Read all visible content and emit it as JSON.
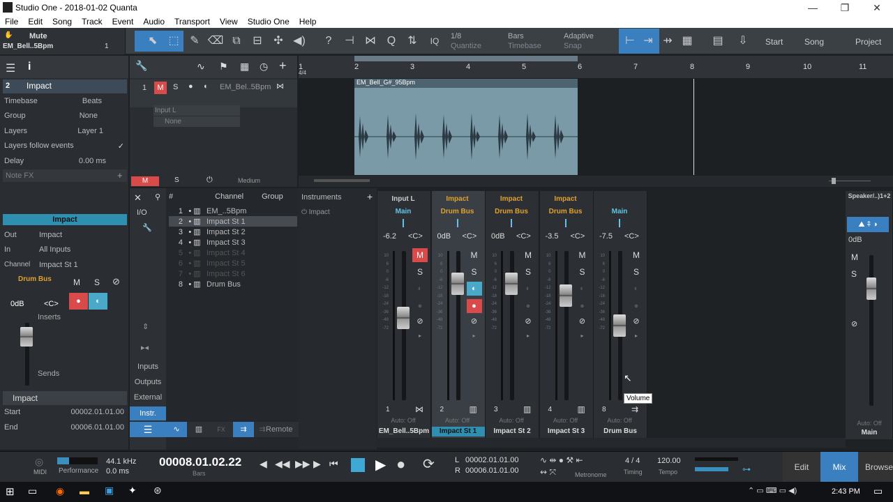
{
  "window": {
    "title": "Studio One - 2018-01-02 Quanta",
    "min": "—",
    "max": "❐",
    "close": "✕"
  },
  "menu": [
    "File",
    "Edit",
    "Song",
    "Track",
    "Event",
    "Audio",
    "Transport",
    "View",
    "Studio One",
    "Help"
  ],
  "toolbar": {
    "mute_label": "Mute",
    "track_name": "EM_Bell..5Bpm",
    "track_num": "1",
    "quantize_val": "1/8",
    "quantize_lbl": "Quantize",
    "timebase_val": "Bars",
    "timebase_lbl": "Timebase",
    "snap_val": "Adaptive",
    "snap_lbl": "Snap",
    "iq": "IQ",
    "start": "Start",
    "song": "Song",
    "project": "Project"
  },
  "inspector": {
    "track_num": "2",
    "track_name": "Impact",
    "rows": [
      {
        "k": "Timebase",
        "v": "Beats"
      },
      {
        "k": "Group",
        "v": "None"
      },
      {
        "k": "Layers",
        "v": "Layer 1"
      },
      {
        "k": "Layers follow events",
        "v": "✓"
      },
      {
        "k": "Delay",
        "v": "0.00 ms"
      }
    ],
    "note_fx": "Note FX",
    "channel_title": "Impact",
    "io": [
      {
        "k": "Out",
        "v": "Impact"
      },
      {
        "k": "In",
        "v": "All Inputs"
      },
      {
        "k": "Channel",
        "v": "Impact St 1"
      }
    ],
    "bus": "Drum Bus",
    "m": "M",
    "s": "S",
    "vol": "0dB",
    "pan": "<C>",
    "inserts": "Inserts",
    "sends": "Sends",
    "event_title": "Impact",
    "start_k": "Start",
    "start_v": "00002.01.01.00",
    "end_k": "End",
    "end_v": "00006.01.01.00"
  },
  "arrange": {
    "track_num": "1",
    "track_name": "EM_Bel..5Bpm",
    "m": "M",
    "s": "S",
    "input": "Input L",
    "none": "None",
    "clip_name": "EM_Bell_G#_95Bpm",
    "sig": "4/4",
    "ruler": [
      "1",
      "2",
      "3",
      "4",
      "5",
      "6",
      "7",
      "8",
      "9",
      "10",
      "11"
    ],
    "foot_m": "M",
    "foot_s": "S",
    "foot_medium": "Medium"
  },
  "channel_list": {
    "col_channel": "Channel",
    "col_group": "Group",
    "col_hash": "#",
    "io": "I/O",
    "rows": [
      {
        "n": "1",
        "name": "EM_..5Bpm",
        "dim": false,
        "sel": false
      },
      {
        "n": "2",
        "name": "Impact St 1",
        "dim": false,
        "sel": true
      },
      {
        "n": "3",
        "name": "Impact St 2",
        "dim": false,
        "sel": false
      },
      {
        "n": "4",
        "name": "Impact St 3",
        "dim": false,
        "sel": false
      },
      {
        "n": "5",
        "name": "Impact St 4",
        "dim": true,
        "sel": false
      },
      {
        "n": "6",
        "name": "Impact St 5",
        "dim": true,
        "sel": false
      },
      {
        "n": "7",
        "name": "Impact St 6",
        "dim": true,
        "sel": false
      },
      {
        "n": "8",
        "name": "Drum Bus",
        "dim": false,
        "sel": false
      }
    ],
    "side": [
      "Inputs",
      "Outputs",
      "External",
      "Instr."
    ],
    "instruments": "Instruments",
    "instr_item": "Impact",
    "remote": "Remote"
  },
  "mixer": {
    "scale": [
      "10",
      "6",
      "0",
      "-6",
      "-12",
      "-18",
      "-24",
      "-36",
      "-48",
      "-72"
    ],
    "auto": "Auto: Off",
    "strips": [
      {
        "top": "Input L",
        "route": "Main",
        "vol": "-6.2",
        "pan": "<C>",
        "num": "1",
        "name": "EM_Bell..5Bpm",
        "m_on": true,
        "fader": 0.55
      },
      {
        "top": "Impact",
        "route": "Drum Bus",
        "vol": "0dB",
        "pan": "<C>",
        "num": "2",
        "name": "Impact St 1",
        "m_on": false,
        "fader": 0.78,
        "sel": true
      },
      {
        "top": "Impact",
        "route": "Drum Bus",
        "vol": "0dB",
        "pan": "<C>",
        "num": "3",
        "name": "Impact St 2",
        "m_on": false,
        "fader": 0.78
      },
      {
        "top": "Impact",
        "route": "Drum Bus",
        "vol": "-3.5",
        "pan": "<C>",
        "num": "4",
        "name": "Impact St 3",
        "m_on": false,
        "fader": 0.7
      },
      {
        "top": "",
        "route": "Main",
        "vol": "-7.5",
        "pan": "<C>",
        "num": "8",
        "name": "Drum Bus",
        "m_on": false,
        "fader": 0.5
      }
    ],
    "main": {
      "top": "Speaker/..)1+2",
      "vol": "0dB",
      "name": "Main",
      "auto": "Auto: Off"
    },
    "tooltip": "Volume"
  },
  "transport": {
    "midi": "MIDI",
    "performance": "Performance",
    "rate": "44.1 kHz",
    "latency": "0.0 ms",
    "time": "00008.01.02.22",
    "time_unit": "Bars",
    "l": "L",
    "l_val": "00002.01.01.00",
    "r": "R",
    "r_val": "00006.01.01.00",
    "metronome": "Metronome",
    "sig": "4 / 4",
    "timing": "Timing",
    "tempo_val": "120.00",
    "tempo": "Tempo",
    "edit": "Edit",
    "mix": "Mix",
    "browse": "Browse"
  },
  "taskbar": {
    "time": "2:43 PM"
  }
}
